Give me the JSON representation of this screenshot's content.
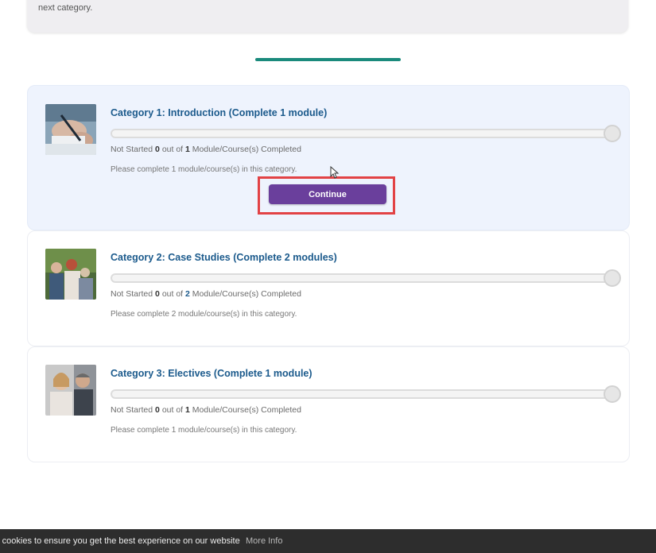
{
  "intro": {
    "text": "next category."
  },
  "categories": [
    {
      "title": "Category 1: Introduction (Complete 1 module)",
      "status_prefix": "Not Started",
      "completed": "0",
      "out_of_text": "out of",
      "total": "1",
      "status_suffix": "Module/Course(s) Completed",
      "note": "Please complete 1 module/course(s) in this category.",
      "progress": 0,
      "button_label": "Continue",
      "thumbnail_icon": "hands-writing-photo"
    },
    {
      "title": "Category 2: Case Studies (Complete 2 modules)",
      "status_prefix": "Not Started",
      "completed": "0",
      "out_of_text": "out of",
      "total": "2",
      "status_suffix": "Module/Course(s) Completed",
      "note": "Please complete 2 module/course(s) in this category.",
      "progress": 0,
      "thumbnail_icon": "group-people-photo"
    },
    {
      "title": "Category 3: Electives (Complete 1 module)",
      "status_prefix": "Not Started",
      "completed": "0",
      "out_of_text": "out of",
      "total": "1",
      "status_suffix": "Module/Course(s) Completed",
      "note": "Please complete 1 module/course(s) in this category.",
      "progress": 0,
      "thumbnail_icon": "two-people-photo"
    }
  ],
  "cookie_bar": {
    "text": "es cookies to ensure you get the best experience on our website",
    "link": "More Info"
  },
  "colors": {
    "accent_teal": "#1a8a7c",
    "title_blue": "#1b5a8c",
    "button_purple": "#6a3f9c",
    "highlight_red": "#e24245",
    "cookie_bg": "#2d2d2d"
  }
}
